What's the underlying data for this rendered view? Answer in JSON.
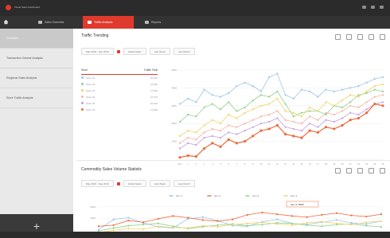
{
  "app": {
    "title": "Visual Sales Dashboard"
  },
  "window_controls": [
    "minimize-icon",
    "maximize-icon",
    "close-icon"
  ],
  "nav": {
    "items": [
      {
        "label": "Home",
        "icon": "home-icon"
      },
      {
        "label": "Sales Overview",
        "icon": "document-icon"
      },
      {
        "label": "Traffic Analysis",
        "icon": "chart-icon",
        "active": true
      },
      {
        "label": "Reports",
        "icon": "report-icon"
      }
    ]
  },
  "sidebar": {
    "items": [
      {
        "label": "Overview",
        "active": true
      },
      {
        "label": "Transaction Volume Analysis"
      },
      {
        "label": "Regional Sales Analysis"
      },
      {
        "label": "Store Traffic Analysis"
      }
    ],
    "add_symbol": "+"
  },
  "section1": {
    "title": "Traffic Trending",
    "filters": {
      "date_range": "May 2016 - Sep 2016",
      "f1": "Global Sales",
      "f2": "Last Week",
      "f3": "Last Month"
    },
    "legend_header": {
      "name": "Store",
      "total": "Traffic Total"
    },
    "legend_rows": [
      {
        "name": "Store 01",
        "total": "20,340",
        "color": "#9ec6ea"
      },
      {
        "name": "Store 02",
        "total": "18,430",
        "color": "#8fd18a"
      },
      {
        "name": "Store 03",
        "total": "17,920",
        "color": "#f2d36b"
      },
      {
        "name": "Store 04",
        "total": "16,870",
        "color": "#f7b3a8"
      },
      {
        "name": "Store 05",
        "total": "15,910",
        "color": "#c2a0e0"
      },
      {
        "name": "Store 06",
        "total": "14,980",
        "color": "#ee6a3c"
      }
    ]
  },
  "section2": {
    "title": "Commodity Sales Volume Statistic",
    "filters": {
      "date_range": "May 2016 - Sep 2016",
      "f1": "Global Sales",
      "f2": "Last Week",
      "f3": "Last Month"
    },
    "legend": [
      "Item 1",
      "Item 2",
      "Item 3",
      "Item 4"
    ],
    "tooltip": "Item 2: 5000"
  },
  "chart_data": [
    {
      "type": "line",
      "title": "Traffic Trending",
      "categories": [
        "Mon",
        "1",
        "2",
        "3",
        "4",
        "5",
        "6",
        "7",
        "8",
        "9",
        "10",
        "11",
        "12",
        "13",
        "14",
        "15",
        "16",
        "17",
        "18",
        "19",
        "20",
        "21",
        "22",
        "23",
        "24",
        "25"
      ],
      "ylim": [
        0,
        5000
      ],
      "yticks": [
        "",
        "1000",
        "2000",
        "3000",
        "4000",
        "5000"
      ],
      "series": [
        {
          "color": "#9ec6ea",
          "values": [
            3100,
            3400,
            3200,
            3900,
            3600,
            3500,
            3700,
            4100,
            4300,
            4100,
            3800,
            4600,
            4800,
            3600,
            3400,
            3900,
            3800,
            3500,
            3900,
            3800,
            3900,
            4000,
            4100,
            4300,
            4500,
            4600
          ]
        },
        {
          "color": "#8fd18a",
          "values": [
            2100,
            2500,
            2400,
            2900,
            3100,
            2800,
            3200,
            2700,
            2900,
            3300,
            3600,
            3500,
            3800,
            3100,
            2400,
            2600,
            2700,
            2700,
            2500,
            3000,
            2900,
            3200,
            3600,
            3700,
            3900,
            3800
          ]
        },
        {
          "color": "#f2d36b",
          "values": [
            1300,
            1600,
            1500,
            1900,
            2200,
            2000,
            2500,
            2300,
            2600,
            2800,
            3000,
            3100,
            3400,
            2700,
            2600,
            2400,
            2900,
            2700,
            3200,
            3000,
            3300,
            3600,
            3500,
            3800,
            4100,
            4200
          ]
        },
        {
          "color": "#f7b3a8",
          "values": [
            900,
            1200,
            1100,
            1500,
            1700,
            1600,
            1900,
            1800,
            2000,
            2200,
            2400,
            2500,
            2700,
            2200,
            2100,
            2000,
            2400,
            2200,
            2600,
            2500,
            2700,
            3000,
            2900,
            3200,
            3500,
            3600
          ]
        },
        {
          "color": "#c2a0e0",
          "values": [
            600,
            900,
            800,
            1200,
            1300,
            1200,
            1500,
            1400,
            1600,
            1800,
            2000,
            2100,
            2300,
            1800,
            1700,
            1600,
            2000,
            1800,
            2200,
            2100,
            2300,
            2600,
            2500,
            2800,
            3100,
            3200
          ]
        },
        {
          "color": "#ee6a3c",
          "values": [
            100,
            200,
            150,
            600,
            900,
            700,
            1100,
            900,
            1000,
            1300,
            1600,
            1700,
            1900,
            1400,
            1300,
            1200,
            1600,
            1500,
            1800,
            1700,
            1900,
            2200,
            2300,
            2600,
            3100,
            3000
          ]
        }
      ]
    },
    {
      "type": "line",
      "title": "Commodity Sales Volume Statistic",
      "ylim": [
        0,
        8000
      ],
      "yticks": [
        "6000",
        "4000"
      ],
      "series": [
        {
          "name": "Item 1",
          "color": "#9ec6ea",
          "values": [
            2000,
            3800,
            4100,
            3200,
            2500,
            2300,
            3900,
            4200,
            3600,
            2700,
            2600,
            3400,
            3800,
            3100,
            2900,
            3300,
            3700,
            3200,
            3000,
            3500
          ]
        },
        {
          "name": "Item 2",
          "color": "#ee6a3c",
          "values": [
            2600,
            2800,
            3600,
            3300,
            3900,
            4400,
            4100,
            3700,
            3500,
            3800,
            4600,
            5000,
            4700,
            4400,
            4200,
            4600,
            4900,
            4500,
            4300,
            4700
          ]
        },
        {
          "name": "Item 3",
          "color": "#8fd18a",
          "values": [
            1800,
            2300,
            2700,
            2900,
            3100,
            2600,
            2200,
            2500,
            2800,
            3000,
            2700,
            2900,
            3200,
            3100,
            2800,
            2600,
            2900,
            3000,
            2700,
            2500
          ]
        },
        {
          "name": "Item 4",
          "color": "#f2d36b",
          "values": [
            1500,
            1900,
            2200,
            2100,
            2600,
            2400,
            2300,
            2700,
            2500,
            2900,
            3100,
            3300,
            3000,
            2800,
            3200,
            3400,
            3100,
            2900,
            3300,
            3500
          ]
        }
      ]
    }
  ]
}
